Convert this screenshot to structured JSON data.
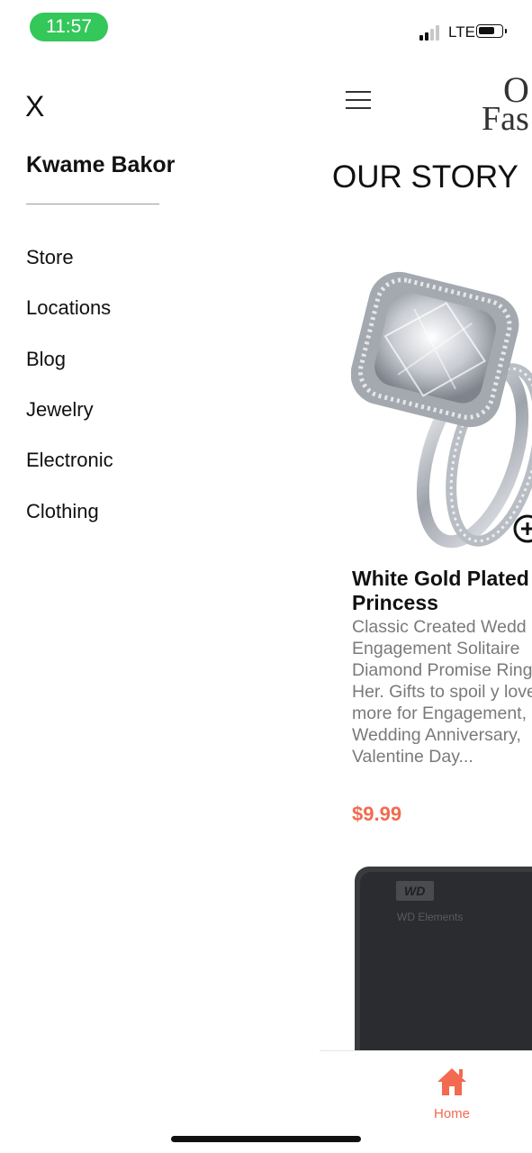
{
  "status_bar": {
    "time": "11:57",
    "network": "LTE"
  },
  "drawer": {
    "close_label": "X",
    "user_name": "Kwame Bakor",
    "items": [
      {
        "label": "Store"
      },
      {
        "label": "Locations"
      },
      {
        "label": "Blog"
      },
      {
        "label": "Jewelry"
      },
      {
        "label": "Electronic"
      },
      {
        "label": "Clothing"
      }
    ]
  },
  "header": {
    "logo_line1": "O",
    "logo_line2": "Fas",
    "page_title": "OUR STORY"
  },
  "products": [
    {
      "title": "White Gold Plated Princess",
      "description": "Classic Created Wedd Engagement Solitaire Diamond Promise Ring for Her. Gifts to spoil y love more for Engagement, Wedding Anniversary, Valentine Day...",
      "price": "$9.99",
      "image_icon": "diamond-ring-image"
    },
    {
      "image_icon": "external-hard-drive-image",
      "image_text_brand": "WD",
      "image_text_model": "WD Elements"
    }
  ],
  "tab_bar": {
    "home_label": "Home",
    "home_icon": "home-icon"
  },
  "colors": {
    "accent": "#f26a4f",
    "status_pill": "#34c759",
    "description_text": "#7a7a7a"
  }
}
